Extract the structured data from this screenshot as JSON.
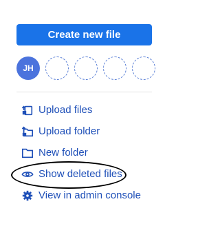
{
  "create_button": {
    "label": "Create new file"
  },
  "avatar": {
    "initials": "JH",
    "color": "#4b73dd"
  },
  "empty_slot_count": 4,
  "menu": {
    "items": [
      {
        "label": "Upload files",
        "icon": "upload-files-icon"
      },
      {
        "label": "Upload folder",
        "icon": "upload-folder-icon"
      },
      {
        "label": "New folder",
        "icon": "new-folder-icon"
      },
      {
        "label": "Show deleted files",
        "icon": "eye-icon"
      },
      {
        "label": "View in admin console",
        "icon": "gear-icon"
      }
    ]
  },
  "colors": {
    "primary": "#1a73e8",
    "link": "#1e4fb8"
  }
}
